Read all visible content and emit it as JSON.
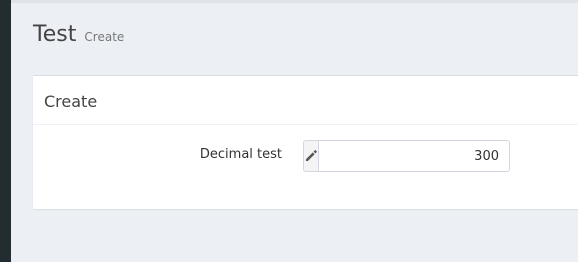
{
  "header": {
    "title": "Test",
    "subtitle": "Create"
  },
  "box": {
    "title": "Create"
  },
  "form": {
    "field_label": "Decimal test",
    "field_value": "300",
    "addon_icon": "pencil-icon"
  },
  "colors": {
    "sidebar": "#222d32",
    "background": "#ecf0f5"
  }
}
